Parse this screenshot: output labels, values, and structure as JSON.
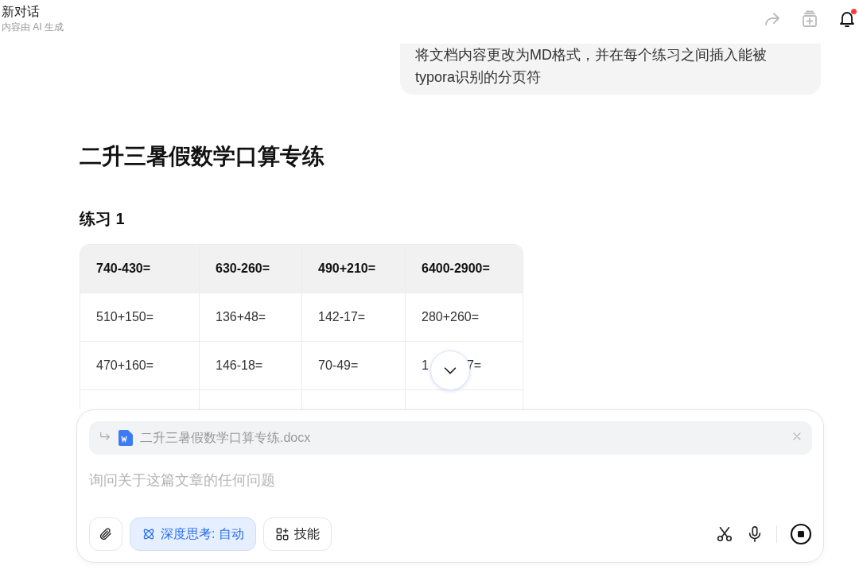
{
  "header": {
    "title": "新对话",
    "subtitle": "内容由 AI 生成",
    "notification_badge": true
  },
  "user_message": {
    "text": "将文档内容更改为MD格式，并在每个练习之间插入能被typora识别的分页符"
  },
  "document": {
    "title": "二升三暑假数学口算专练",
    "section": "练习 1",
    "table": {
      "columns": [
        "740-430=",
        "630-260=",
        "490+210=",
        "6400-2900="
      ],
      "rows": [
        [
          "510+150=",
          "136+48=",
          "142-17=",
          "280+260="
        ],
        [
          "470+160=",
          "146-18=",
          "70-49=",
          [
            "1",
            "7="
          ]
        ]
      ]
    }
  },
  "composer": {
    "attachment": {
      "file_name": "二升三暑假数学口算专练.docx"
    },
    "placeholder": "询问关于这篇文章的任何问题",
    "buttons": [
      {
        "kind": "attach"
      },
      {
        "kind": "deep-think",
        "label": "深度思考: 自动",
        "selected": true
      },
      {
        "kind": "skills",
        "label": "技能"
      }
    ]
  }
}
